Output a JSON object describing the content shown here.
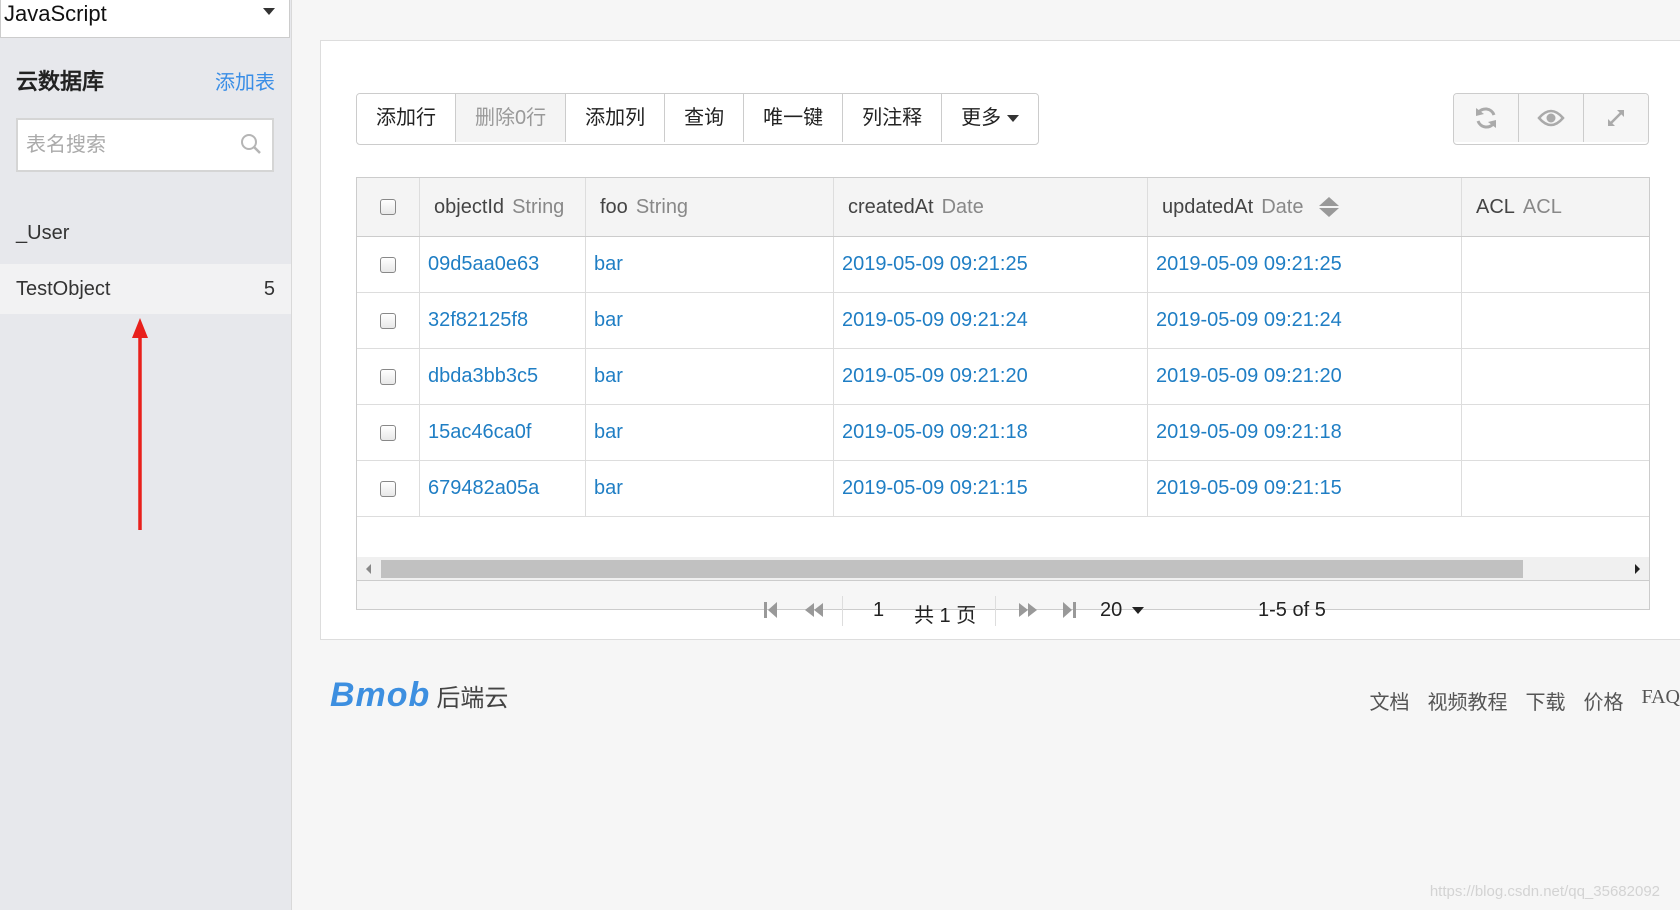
{
  "sidebar": {
    "language": "JavaScript",
    "title": "云数据库",
    "add_table": "添加表",
    "search_placeholder": "表名搜索",
    "tables": [
      {
        "name": "_User",
        "count": ""
      },
      {
        "name": "TestObject",
        "count": "5"
      }
    ]
  },
  "toolbar": {
    "add_row": "添加行",
    "delete_rows": "删除0行",
    "add_column": "添加列",
    "query": "查询",
    "unique_key": "唯一键",
    "column_comment": "列注释",
    "more": "更多"
  },
  "right_tools": {
    "refresh_icon": "refresh-icon",
    "view_icon": "eye-icon",
    "fullscreen_icon": "expand-icon"
  },
  "grid": {
    "columns": [
      {
        "name": "objectId",
        "type": "String"
      },
      {
        "name": "foo",
        "type": "String"
      },
      {
        "name": "createdAt",
        "type": "Date"
      },
      {
        "name": "updatedAt",
        "type": "Date"
      },
      {
        "name": "ACL",
        "type": "ACL"
      }
    ],
    "rows": [
      {
        "objectId": "09d5aa0e63",
        "foo": "bar",
        "createdAt": "2019-05-09 09:21:25",
        "updatedAt": "2019-05-09 09:21:25",
        "acl": ""
      },
      {
        "objectId": "32f82125f8",
        "foo": "bar",
        "createdAt": "2019-05-09 09:21:24",
        "updatedAt": "2019-05-09 09:21:24",
        "acl": ""
      },
      {
        "objectId": "dbda3bb3c5",
        "foo": "bar",
        "createdAt": "2019-05-09 09:21:20",
        "updatedAt": "2019-05-09 09:21:20",
        "acl": ""
      },
      {
        "objectId": "15ac46ca0f",
        "foo": "bar",
        "createdAt": "2019-05-09 09:21:18",
        "updatedAt": "2019-05-09 09:21:18",
        "acl": ""
      },
      {
        "objectId": "679482a05a",
        "foo": "bar",
        "createdAt": "2019-05-09 09:21:15",
        "updatedAt": "2019-05-09 09:21:15",
        "acl": ""
      }
    ]
  },
  "pager": {
    "page": "1",
    "total_pages": "共 1 页",
    "page_size": "20",
    "range": "1-5 of 5"
  },
  "footer": {
    "logo": "Bmob",
    "logo_suffix": "后端云",
    "links": [
      "文档",
      "视频教程",
      "下载",
      "价格",
      "FAQ"
    ],
    "watermark": "https://blog.csdn.net/qq_35682092"
  },
  "colors": {
    "link": "#1f7ec4",
    "accent": "#3a8ee6",
    "annotation_arrow": "#e8201c"
  }
}
